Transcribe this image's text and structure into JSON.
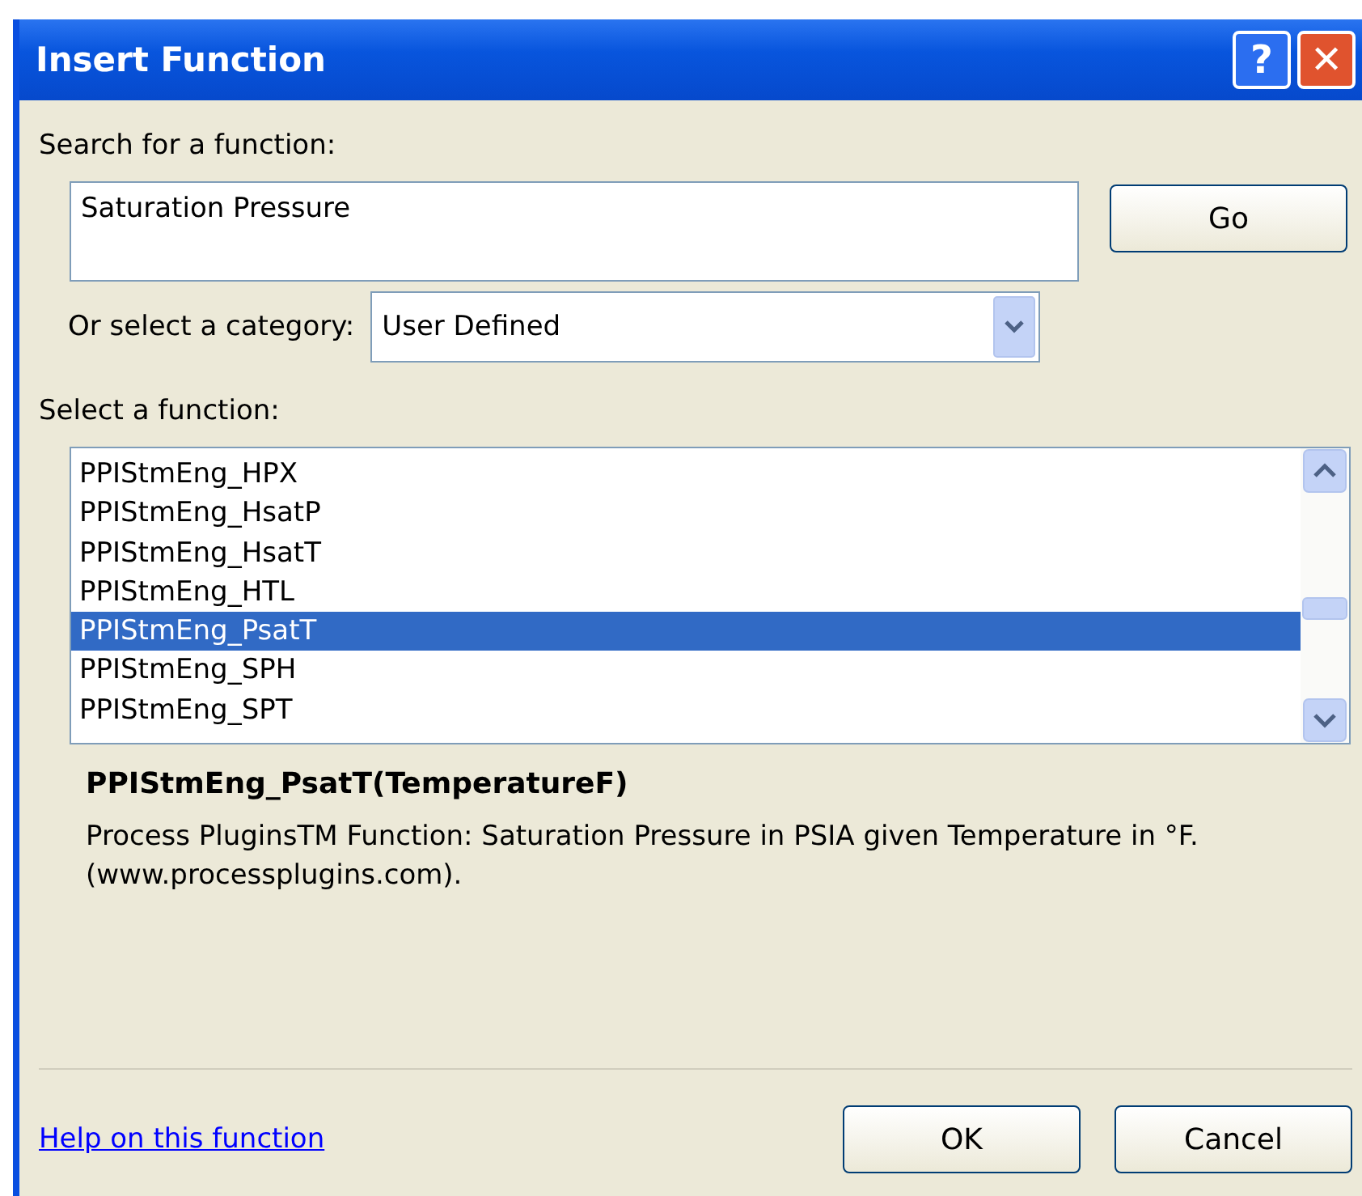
{
  "window": {
    "title": "Insert Function",
    "help_glyph": "?",
    "close_glyph": "✕"
  },
  "search": {
    "label": "Search for a function:",
    "value": "Saturation Pressure",
    "go_button": "Go"
  },
  "category": {
    "label": "Or select a category:",
    "value": "User Defined"
  },
  "functions": {
    "label": "Select a function:",
    "items": [
      {
        "name": "PPIStmEng_HPX",
        "selected": false
      },
      {
        "name": "PPIStmEng_HsatP",
        "selected": false
      },
      {
        "name": "PPIStmEng_HsatT",
        "selected": false
      },
      {
        "name": "PPIStmEng_HTL",
        "selected": false
      },
      {
        "name": "PPIStmEng_PsatT",
        "selected": true
      },
      {
        "name": "PPIStmEng_SPH",
        "selected": false
      },
      {
        "name": "PPIStmEng_SPT",
        "selected": false
      }
    ]
  },
  "signature": "PPIStmEng_PsatT(TemperatureF)",
  "description": "Process PluginsTM Function: Saturation Pressure in PSIA given Temperature in °F. (www.processplugins.com).",
  "help_link": "Help on this function",
  "buttons": [
    "OK",
    "Cancel"
  ]
}
